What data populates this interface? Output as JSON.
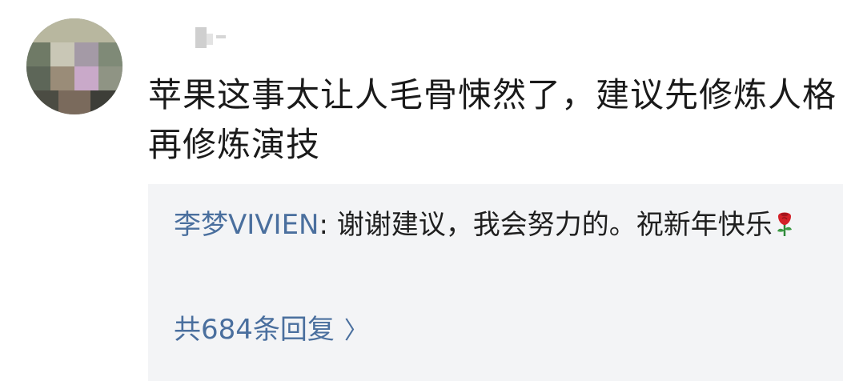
{
  "comment": {
    "username": "",
    "text": "苹果这事太让人毛骨悚然了，建议先修炼人格再修炼演技"
  },
  "reply": {
    "author": "李梦VIVIEN",
    "separator": ": ",
    "text": "谢谢建议，我会努力的。祝新年快乐",
    "emoji_icon": "rose-icon",
    "count_label": "共684条回复",
    "chevron_icon": "chevron-right-icon"
  },
  "colors": {
    "link": "#4a6f9e",
    "reply_background": "#f3f4f6",
    "text": "#1a1a1a"
  }
}
